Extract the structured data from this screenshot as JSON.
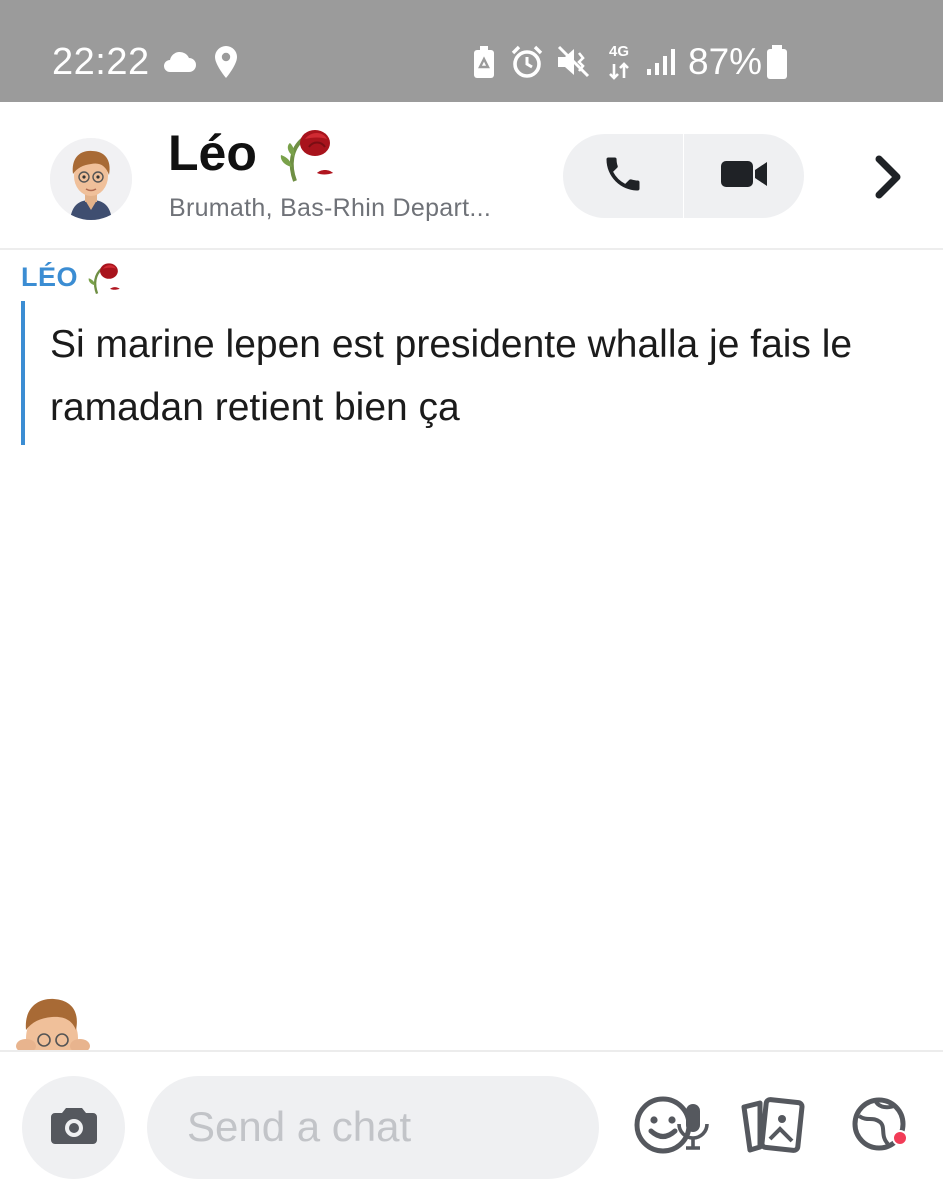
{
  "status_bar": {
    "time": "22:22",
    "network": "4G",
    "battery": "87%",
    "icons": [
      "cloud-icon",
      "location-pin-icon",
      "battery-saver-icon",
      "alarm-icon",
      "vibrate-icon",
      "network-4g-icon",
      "signal-icon",
      "battery-icon"
    ]
  },
  "header": {
    "name": "Léo",
    "subtitle": "Brumath, Bas-Rhin Depart...",
    "icons": [
      "avatar-bitmoji",
      "wilted-rose-emoji",
      "phone-call-icon",
      "video-call-icon",
      "chevron-right-icon"
    ]
  },
  "chat": {
    "messages": [
      {
        "sender": "LÉO",
        "text": "Si marine lepen est presidente whalla je fais le ramadan retient bien ça"
      }
    ]
  },
  "composer": {
    "placeholder": "Send a chat",
    "icons": [
      "camera-icon",
      "microphone-icon",
      "emoji-icon",
      "memories-cards-icon",
      "lens-globe-icon"
    ]
  },
  "colors": {
    "status_bar": "#9b9b9b",
    "accent_blue": "#3b8dd3",
    "pill_bg": "#eff0f2",
    "icon_dark": "#1f2226",
    "notification_dot": "#f23c57"
  }
}
